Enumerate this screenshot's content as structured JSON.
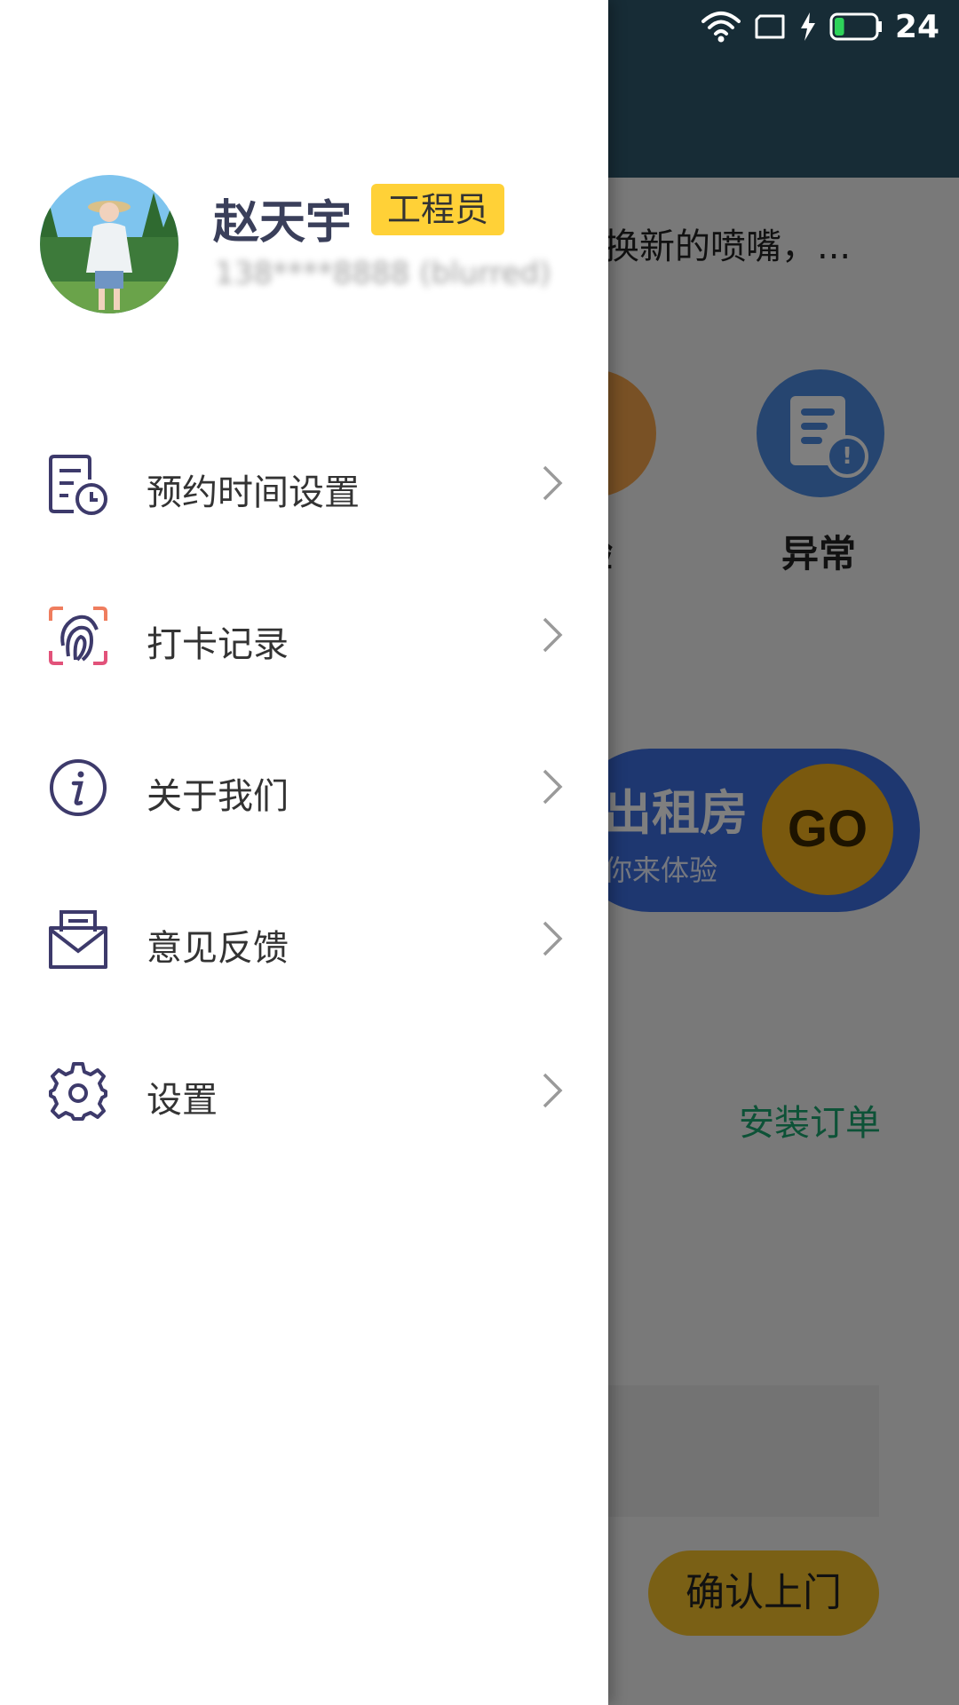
{
  "background": {
    "notice_text": "换新的喷嘴，...",
    "icon_labels": [
      "验",
      "异常"
    ],
    "banner": {
      "title": "出租房",
      "subtitle": "你来体验",
      "go_label": "GO"
    },
    "order_label": "安装订单",
    "confirm_button": "确认上门"
  },
  "status_bar": {
    "battery_level": "24",
    "battery_fraction": 0.24,
    "icons": [
      "wifi-icon",
      "sim-card-icon",
      "charging-icon",
      "battery-icon"
    ]
  },
  "drawer": {
    "user": {
      "name": "赵天宇",
      "role": "工程员",
      "phone": "138****8888 (blurred)"
    },
    "menu": [
      {
        "label": "预约时间设置",
        "icon": "calendar-clock-icon"
      },
      {
        "label": "打卡记录",
        "icon": "fingerprint-icon"
      },
      {
        "label": "关于我们",
        "icon": "info-icon"
      },
      {
        "label": "意见反馈",
        "icon": "feedback-mail-icon"
      },
      {
        "label": "设置",
        "icon": "gear-icon"
      }
    ]
  },
  "colors": {
    "header_bg": "#2e586c",
    "drawer_bg": "#ffffff",
    "badge_bg": "#ffd137",
    "name_color": "#3a3f5a",
    "icon_color": "#3d3a6b",
    "accent_green": "#1aa56e"
  }
}
